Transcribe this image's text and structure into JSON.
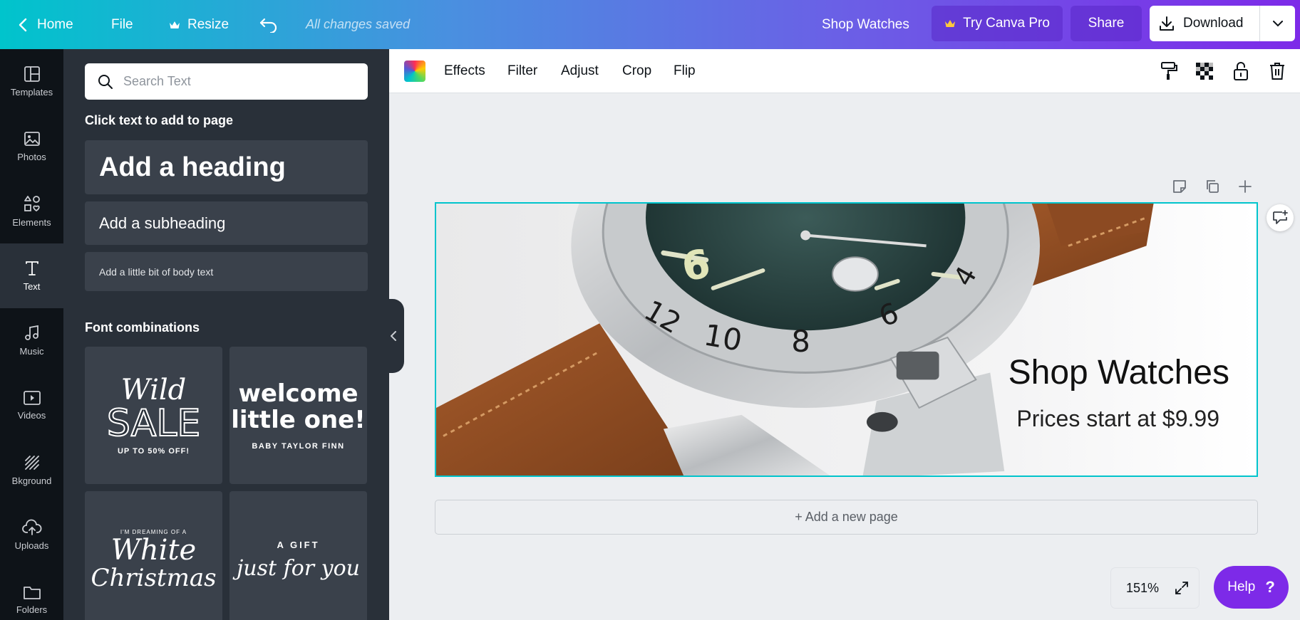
{
  "topbar": {
    "home": "Home",
    "file": "File",
    "resize": "Resize",
    "saved_status": "All changes saved",
    "design_title": "Shop Watches",
    "try_pro": "Try Canva Pro",
    "share": "Share",
    "download": "Download"
  },
  "rail": {
    "items": [
      {
        "label": "Templates",
        "icon": "templates-icon"
      },
      {
        "label": "Photos",
        "icon": "photos-icon"
      },
      {
        "label": "Elements",
        "icon": "elements-icon"
      },
      {
        "label": "Text",
        "icon": "text-icon"
      },
      {
        "label": "Music",
        "icon": "music-icon"
      },
      {
        "label": "Videos",
        "icon": "videos-icon"
      },
      {
        "label": "Bkground",
        "icon": "background-icon"
      },
      {
        "label": "Uploads",
        "icon": "uploads-icon"
      },
      {
        "label": "Folders",
        "icon": "folders-icon"
      }
    ],
    "active": "Text"
  },
  "panel": {
    "search_placeholder": "Search Text",
    "click_hint": "Click text to add to page",
    "heading": "Add a heading",
    "subheading": "Add a subheading",
    "body": "Add a little bit of body text",
    "font_combinations": "Font combinations",
    "combos": [
      {
        "line1": "Wild",
        "line2": "SALE",
        "line3": "UP TO 50% OFF!"
      },
      {
        "line1": "welcome",
        "line2": "little one!",
        "line3": "BABY TAYLOR FINN"
      },
      {
        "line1": "I'M DREAMING OF A",
        "line2": "White",
        "line3": "Christmas"
      },
      {
        "line1": "A GIFT",
        "line2": "just for you",
        "line3": ""
      }
    ]
  },
  "edit_toolbar": {
    "effects": "Effects",
    "filter": "Filter",
    "adjust": "Adjust",
    "crop": "Crop",
    "flip": "Flip"
  },
  "canvas": {
    "title": "Shop Watches",
    "subtitle": "Prices start at $9.99",
    "add_page": "+ Add a new page",
    "bezel_numbers": [
      "12",
      "10",
      "8",
      "6",
      "4"
    ]
  },
  "footer": {
    "zoom": "151%",
    "help": "Help",
    "help_icon": "?"
  },
  "colors": {
    "accent": "#00c4cc",
    "brand_purple": "#7d2ae8",
    "panel_bg": "#293039",
    "rail_bg": "#0e1318"
  }
}
